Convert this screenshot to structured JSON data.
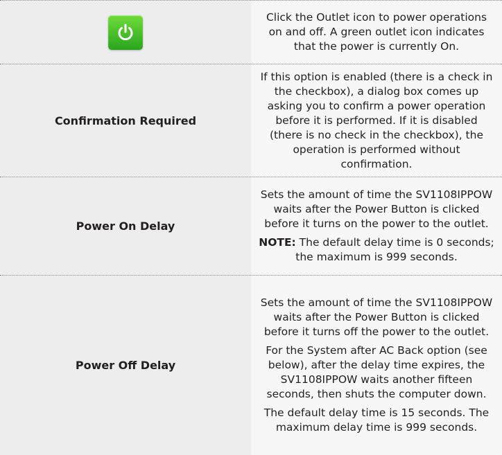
{
  "rows": [
    {
      "icon": "power-outlet-icon",
      "description": [
        "Click the Outlet icon to power operations on and off. A green outlet icon indicates that the power is currently On."
      ]
    },
    {
      "label": "Confirmation Required",
      "description": [
        "If this option is enabled (there is a check in the checkbox), a dialog box comes up asking you to confirm a power operation before it is performed. If it is disabled (there is no check in the checkbox), the operation is performed without confirmation."
      ]
    },
    {
      "label": "Power On Delay",
      "description": [
        "Sets the amount of time the SV1108IPPOW waits after the Power Button is clicked before it turns on the power to the outlet."
      ],
      "note_label": "NOTE:",
      "note_text": " The default delay time is 0 seconds; the maximum is 999 seconds."
    },
    {
      "label": "Power Off Delay",
      "description": [
        "Sets the amount of time the SV1108IPPOW waits after the Power Button is clicked before it turns off the power to the outlet.",
        "For the System after AC Back option (see below), after the delay time expires, the SV1108IPPOW waits another fifteen seconds, then shuts the computer down.",
        "The default delay time is 15 seconds. The maximum delay time is 999 seconds."
      ]
    }
  ],
  "colors": {
    "icon_green": "#3cc02a",
    "left_bg": "#ededed",
    "right_bg": "#f7f7f7",
    "divider": "#7a7a7a"
  }
}
